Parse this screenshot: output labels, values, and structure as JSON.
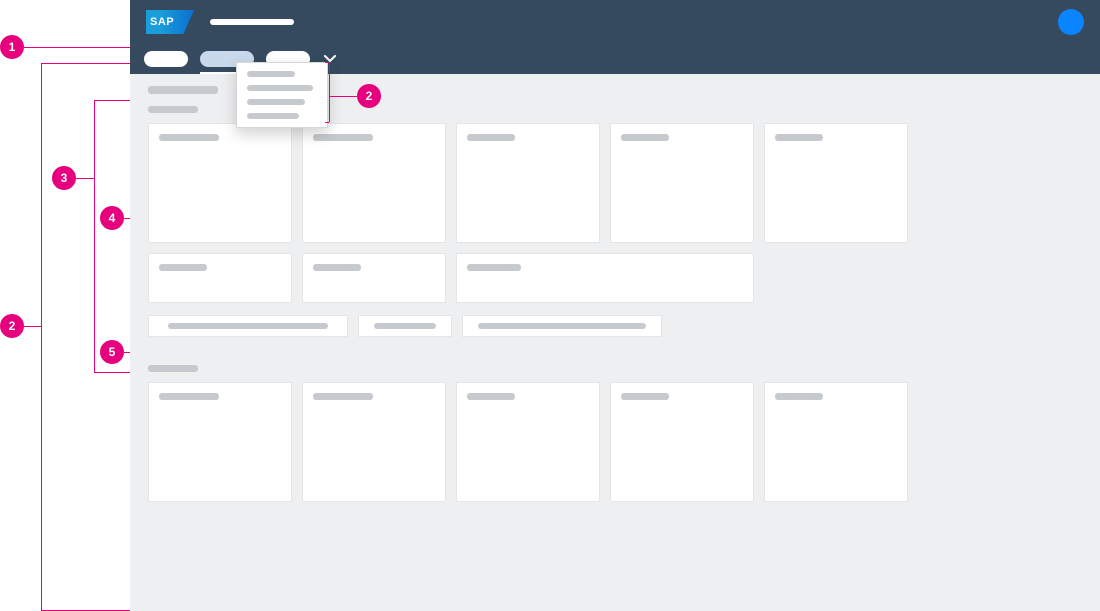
{
  "annotations": {
    "left_rail": {
      "a1": "1",
      "a2": "2",
      "a3": "3",
      "a4": "4",
      "a5": "5"
    },
    "dropdown_marker": "2"
  },
  "shell": {
    "logo_text": "SAP",
    "title_placeholder": "",
    "avatar_color": "#0a84ff"
  },
  "nav": {
    "tabs": [
      {
        "active": false
      },
      {
        "active": true
      },
      {
        "active": false
      }
    ],
    "overflow_icon": "chevron-down"
  },
  "overflow_menu": {
    "items": [
      "",
      "",
      "",
      ""
    ]
  },
  "content": {
    "page_title": "",
    "groups": [
      {
        "title": "",
        "tiles": [
          {
            "size": "regular"
          },
          {
            "size": "regular"
          },
          {
            "size": "regular"
          },
          {
            "size": "regular"
          },
          {
            "size": "regular"
          }
        ],
        "short_tiles": [
          {
            "size": "short"
          },
          {
            "size": "short"
          },
          {
            "size": "wide"
          }
        ],
        "links": [
          "",
          "",
          ""
        ]
      },
      {
        "title": "",
        "tiles": [
          {
            "size": "regular"
          },
          {
            "size": "regular"
          },
          {
            "size": "regular"
          },
          {
            "size": "regular"
          },
          {
            "size": "regular"
          }
        ]
      }
    ]
  }
}
